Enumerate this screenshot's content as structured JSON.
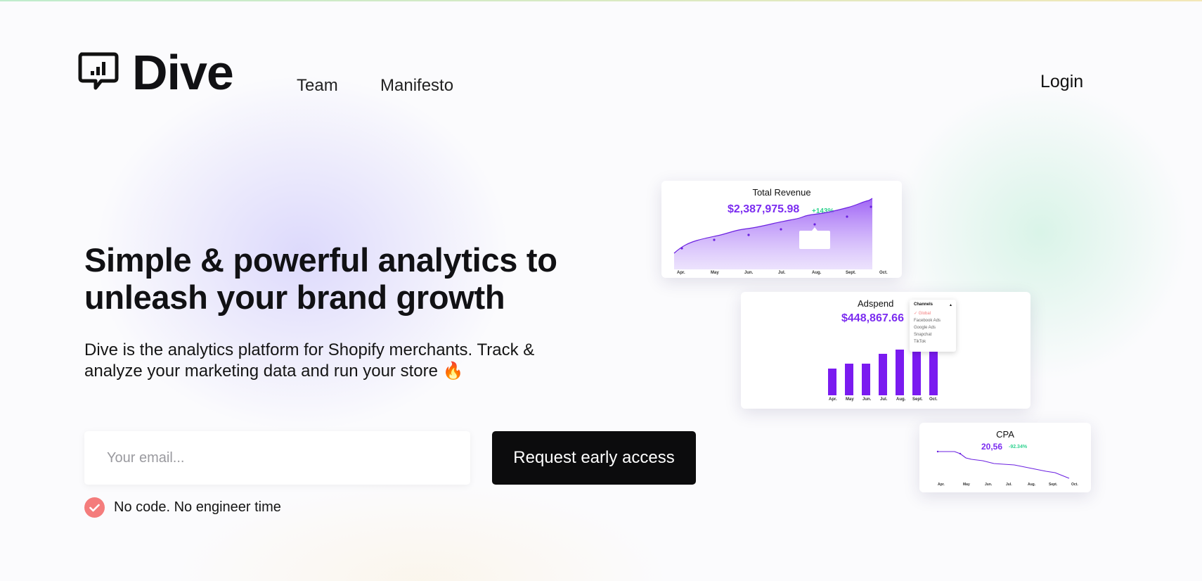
{
  "header": {
    "logo_text": "Dive",
    "nav": {
      "team": "Team",
      "manifesto": "Manifesto"
    },
    "login": "Login"
  },
  "hero": {
    "headline_line1": "Simple & powerful analytics to",
    "headline_line2": "unleash your brand growth",
    "subline_line1": "Dive is the analytics platform for Shopify merchants. Track &",
    "subline_line2": "analyze your marketing data and run your store 🔥",
    "email_placeholder": "Your email...",
    "cta_label": "Request early access",
    "note": "No code. No engineer time"
  },
  "cards": {
    "revenue": {
      "title": "Total Revenue",
      "value": "$2,387,975.98",
      "delta": "+143%",
      "months": [
        "Apr.",
        "May",
        "Jun.",
        "Jul.",
        "Aug.",
        "Sept.",
        "Oct."
      ]
    },
    "adspend": {
      "title": "Adspend",
      "value": "$448,867.66",
      "months": [
        "Apr.",
        "May",
        "Jun.",
        "Jul.",
        "Aug.",
        "Sept.",
        "Oct."
      ],
      "dropdown": {
        "label": "Channels",
        "options": [
          "Global",
          "Facebook Ads",
          "Google Ads",
          "Snapchat",
          "TikTok"
        ]
      }
    },
    "cpa": {
      "title": "CPA",
      "value": "20,56",
      "delta": "-92.34%",
      "months": [
        "Apr.",
        "May",
        "Jun.",
        "Jul.",
        "Aug.",
        "Sept.",
        "Oct."
      ]
    }
  },
  "colors": {
    "accent": "#7b2cf0",
    "cta_bg": "#0c0c0d",
    "check": "#f47c7c",
    "positive": "#2fd28f"
  }
}
